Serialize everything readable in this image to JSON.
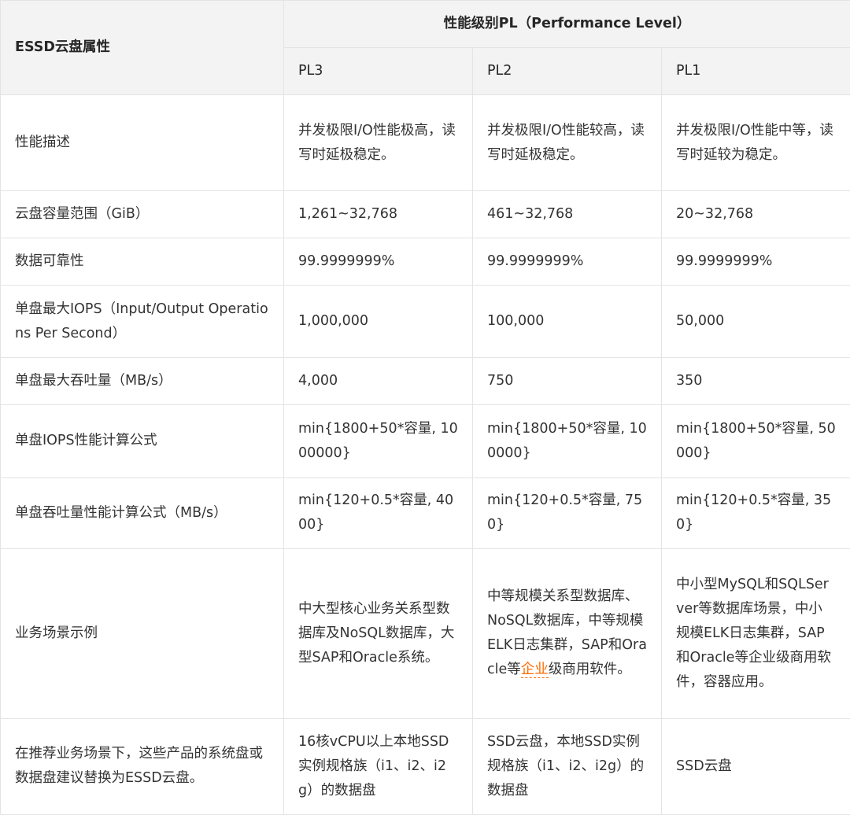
{
  "header": {
    "attr_title": "ESSD云盘属性",
    "level_title": "性能级别PL（Performance Level）",
    "levels": [
      "PL3",
      "PL2",
      "PL1"
    ]
  },
  "rows": [
    {
      "label": "性能描述",
      "pl3": "并发极限I/O性能极高，读写时延极稳定。",
      "pl2": "并发极限I/O性能较高，读写时延极稳定。",
      "pl1": "并发极限I/O性能中等，读写时延较为稳定。"
    },
    {
      "label": "云盘容量范围（GiB）",
      "pl3": "1,261~32,768",
      "pl2": "461~32,768",
      "pl1": "20~32,768"
    },
    {
      "label": "数据可靠性",
      "pl3": "99.9999999%",
      "pl2": "99.9999999%",
      "pl1": "99.9999999%"
    },
    {
      "label": "单盘最大IOPS（Input/Output Operations Per Second）",
      "pl3": "1,000,000",
      "pl2": "100,000",
      "pl1": "50,000"
    },
    {
      "label": "单盘最大吞吐量（MB/s）",
      "pl3": "4,000",
      "pl2": "750",
      "pl1": "350"
    },
    {
      "label": "单盘IOPS性能计算公式",
      "pl3": "min{1800+50*容量, 1000000}",
      "pl2": "min{1800+50*容量, 100000}",
      "pl1": "min{1800+50*容量, 50000}"
    },
    {
      "label": "单盘吞吐量性能计算公式（MB/s）",
      "pl3": "min{120+0.5*容量, 4000}",
      "pl2": "min{120+0.5*容量, 750}",
      "pl1": "min{120+0.5*容量, 350}"
    },
    {
      "label": "业务场景示例",
      "pl3": "中大型核心业务关系型数据库及NoSQL数据库，大型SAP和Oracle系统。",
      "pl2_before": "中等规模关系型数据库、NoSQL数据库，中等规模ELK日志集群，SAP和Oracle等",
      "pl2_link": "企业",
      "pl2_after": "级商用软件。",
      "pl1": "中小型MySQL和SQLServer等数据库场景，中小规模ELK日志集群，SAP和Oracle等企业级商用软件，容器应用。"
    },
    {
      "label": "在推荐业务场景下，这些产品的系统盘或数据盘建议替换为ESSD云盘。",
      "pl3": "16核vCPU以上本地SSD实例规格族（i1、i2、i2g）的数据盘",
      "pl2": "SSD云盘，本地SSD实例规格族（i1、i2、i2g）的数据盘",
      "pl1": "SSD云盘"
    }
  ],
  "colors": {
    "header_bg": "#f3f3f3",
    "border": "#e4e4e4",
    "link": "#ff6a00"
  }
}
